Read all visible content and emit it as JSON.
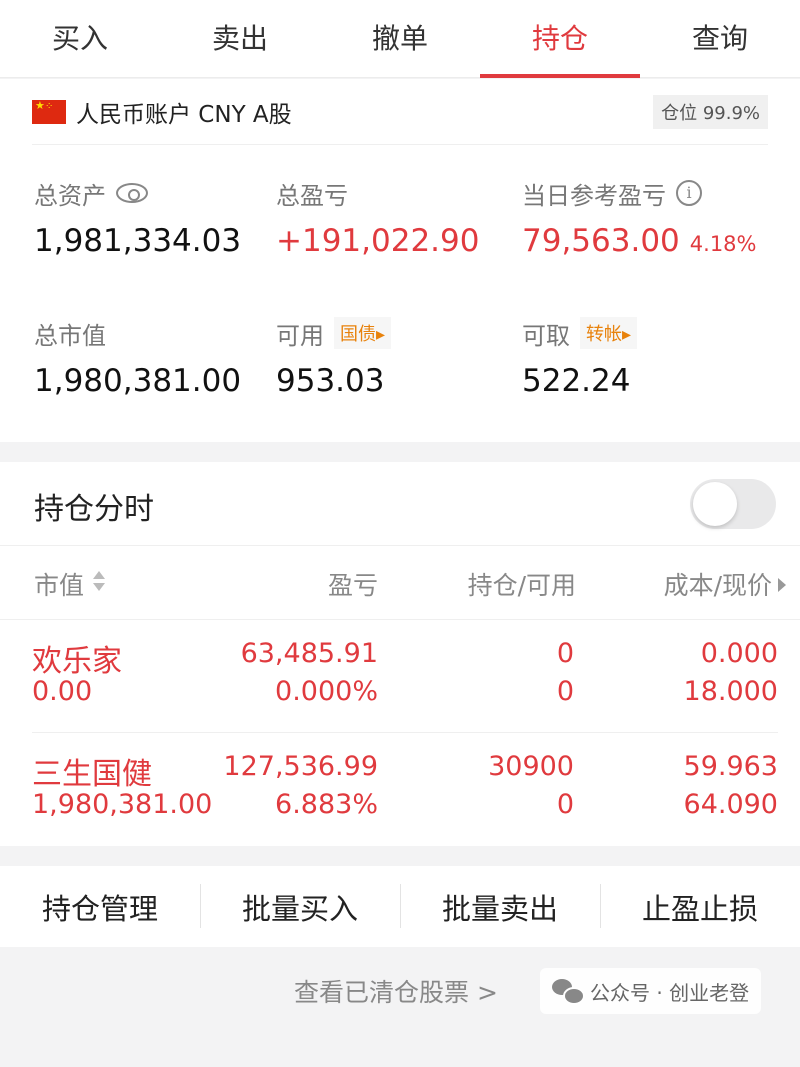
{
  "tabs": [
    "买入",
    "卖出",
    "撤单",
    "持仓",
    "查询"
  ],
  "account": {
    "title": "人民币账户 CNY A股",
    "position_ratio": "仓位 99.9%",
    "total_assets_label": "总资产",
    "total_assets": "1,981,334.03",
    "total_pnl_label": "总盈亏",
    "total_pnl": "+191,022.90",
    "daily_pnl_label": "当日参考盈亏",
    "daily_pnl": "79,563.00",
    "daily_pnl_pct": "4.18%",
    "market_value_label": "总市值",
    "market_value": "1,980,381.00",
    "available_label": "可用",
    "available_tag": "国债▸",
    "available": "953.03",
    "withdrawable_label": "可取",
    "withdrawable_tag": "转帐▸",
    "withdrawable": "522.24"
  },
  "holdings": {
    "title": "持仓分时",
    "toggle_on": false,
    "columns": [
      "市值",
      "盈亏",
      "持仓/可用",
      "成本/现价"
    ],
    "rows": [
      {
        "name": "欢乐家",
        "market_value": "0.00",
        "pnl": "63,485.91",
        "pnl_pct": "0.000%",
        "position": "0",
        "available": "0",
        "cost": "0.000",
        "price": "18.000"
      },
      {
        "name": "三生国健",
        "market_value": "1,980,381.00",
        "pnl": "127,536.99",
        "pnl_pct": "6.883%",
        "position": "30900",
        "available": "0",
        "cost": "59.963",
        "price": "64.090"
      }
    ]
  },
  "actions": [
    "持仓管理",
    "批量买入",
    "批量卖出",
    "止盈止损"
  ],
  "footer_link": "查看已清仓股票 >",
  "watermark": "公众号 · 创业老登",
  "colors": {
    "accent": "#e03a3e",
    "tag": "#e8820c"
  }
}
